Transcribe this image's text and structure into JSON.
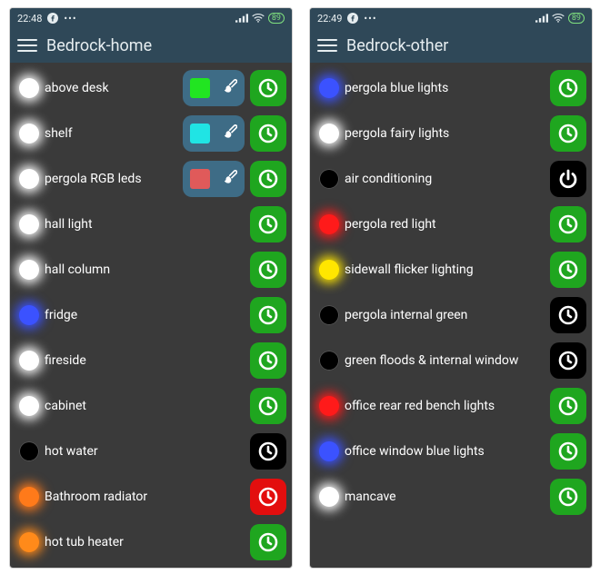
{
  "icons": {
    "fb": "facebook-icon",
    "more": "more-icon",
    "signal": "signal-icon",
    "wifi": "wifi-icon"
  },
  "screens": [
    {
      "time": "22:48",
      "battery": "89",
      "title": "Bedrock-home",
      "rows": [
        {
          "label": "above desk",
          "indicator": "#ffffff",
          "glow": "#ffffff",
          "colorPicker": {
            "swatch": "#21E521"
          },
          "action": {
            "bg": "#1FA61F",
            "icon": "clock",
            "iconColor": "#ffffff"
          }
        },
        {
          "label": "shelf",
          "indicator": "#ffffff",
          "glow": "#ffffff",
          "colorPicker": {
            "swatch": "#20E4E4"
          },
          "action": {
            "bg": "#1FA61F",
            "icon": "clock",
            "iconColor": "#ffffff"
          }
        },
        {
          "label": "pergola RGB leds",
          "indicator": "#ffffff",
          "glow": "#ffffff",
          "colorPicker": {
            "swatch": "#E05A5A"
          },
          "action": {
            "bg": "#1FA61F",
            "icon": "clock",
            "iconColor": "#ffffff"
          }
        },
        {
          "label": "hall light",
          "indicator": "#ffffff",
          "glow": "#ffffff",
          "action": {
            "bg": "#1FA61F",
            "icon": "clock",
            "iconColor": "#ffffff"
          }
        },
        {
          "label": "hall column",
          "indicator": "#ffffff",
          "glow": "#ffffff",
          "action": {
            "bg": "#1FA61F",
            "icon": "clock",
            "iconColor": "#ffffff"
          }
        },
        {
          "label": "fridge",
          "indicator": "#3b52ff",
          "glow": "#3b52ff",
          "action": {
            "bg": "#1FA61F",
            "icon": "clock",
            "iconColor": "#ffffff"
          }
        },
        {
          "label": "fireside",
          "indicator": "#ffffff",
          "glow": "#ffffff",
          "action": {
            "bg": "#1FA61F",
            "icon": "clock",
            "iconColor": "#ffffff"
          }
        },
        {
          "label": "cabinet",
          "indicator": "#ffffff",
          "glow": "#ffffff",
          "action": {
            "bg": "#1FA61F",
            "icon": "clock",
            "iconColor": "#ffffff"
          }
        },
        {
          "label": "hot water",
          "indicator": "#000000",
          "glow": null,
          "action": {
            "bg": "#000000",
            "icon": "clock",
            "iconColor": "#ffffff"
          }
        },
        {
          "label": "Bathroom radiator",
          "indicator": "#ff7a1a",
          "glow": "#ff7a1a",
          "action": {
            "bg": "#E30E0E",
            "icon": "clock",
            "iconColor": "#ffffff"
          }
        },
        {
          "label": "hot tub heater",
          "indicator": "#ff8a1a",
          "glow": "#ff8a1a",
          "action": {
            "bg": "#1FA61F",
            "icon": "clock",
            "iconColor": "#ffffff"
          }
        }
      ]
    },
    {
      "time": "22:49",
      "battery": "89",
      "title": "Bedrock-other",
      "rows": [
        {
          "label": "pergola blue lights",
          "indicator": "#3b52ff",
          "glow": "#3b52ff",
          "action": {
            "bg": "#1FA61F",
            "icon": "clock",
            "iconColor": "#ffffff"
          }
        },
        {
          "label": "pergola fairy lights",
          "indicator": "#ffffff",
          "glow": "#ffffff",
          "action": {
            "bg": "#1FA61F",
            "icon": "clock",
            "iconColor": "#ffffff"
          }
        },
        {
          "label": "air conditioning",
          "indicator": "#000000",
          "glow": null,
          "action": {
            "bg": "#000000",
            "icon": "power",
            "iconColor": "#ffffff"
          }
        },
        {
          "label": "pergola red light",
          "indicator": "#ff1a1a",
          "glow": "#ff1a1a",
          "action": {
            "bg": "#1FA61F",
            "icon": "clock",
            "iconColor": "#ffffff"
          }
        },
        {
          "label": "sidewall flicker lighting",
          "indicator": "#ffe600",
          "glow": "#ffe600",
          "action": {
            "bg": "#1FA61F",
            "icon": "clock",
            "iconColor": "#ffffff"
          }
        },
        {
          "label": "pergola internal green",
          "indicator": "#000000",
          "glow": null,
          "action": {
            "bg": "#000000",
            "icon": "clock",
            "iconColor": "#ffffff"
          }
        },
        {
          "label": "green floods & internal window",
          "indicator": "#000000",
          "glow": null,
          "action": {
            "bg": "#000000",
            "icon": "clock",
            "iconColor": "#ffffff"
          }
        },
        {
          "label": "office rear red bench lights",
          "indicator": "#ff1a1a",
          "glow": "#ff1a1a",
          "action": {
            "bg": "#1FA61F",
            "icon": "clock",
            "iconColor": "#ffffff"
          }
        },
        {
          "label": "office window blue lights",
          "indicator": "#3b52ff",
          "glow": "#3b52ff",
          "action": {
            "bg": "#1FA61F",
            "icon": "clock",
            "iconColor": "#ffffff"
          }
        },
        {
          "label": "mancave",
          "indicator": "#ffffff",
          "glow": "#ffffff",
          "action": {
            "bg": "#1FA61F",
            "icon": "clock",
            "iconColor": "#ffffff"
          }
        }
      ]
    }
  ]
}
